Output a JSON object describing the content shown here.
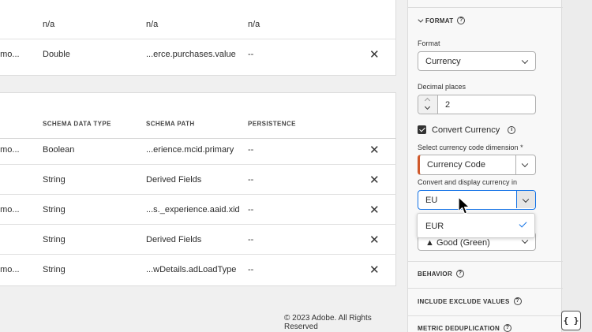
{
  "top_table": {
    "rows": [
      {
        "c1": "",
        "c2": "n/a",
        "c3": "n/a",
        "c4": "n/a",
        "remove": ""
      },
      {
        "c1": "emo...",
        "c2": "Double",
        "c3": "...erce.purchases.value",
        "c4": "--",
        "remove": "✕"
      }
    ]
  },
  "bottom_table": {
    "headers": [
      "SCHEMA DATA TYPE",
      "SCHEMA PATH",
      "PERSISTENCE"
    ],
    "rows": [
      {
        "c1": "emo...",
        "c2": "Boolean",
        "c3": "...erience.mcid.primary",
        "c4": "--",
        "remove": "✕"
      },
      {
        "c1": "",
        "c2": "String",
        "c3": "Derived Fields",
        "c4": "--",
        "remove": "✕"
      },
      {
        "c1": "emo...",
        "c2": "String",
        "c3": "...s._experience.aaid.xid",
        "c4": "--",
        "remove": "✕"
      },
      {
        "c1": "",
        "c2": "String",
        "c3": "Derived Fields",
        "c4": "--",
        "remove": "✕"
      },
      {
        "c1": "emo...",
        "c2": "String",
        "c3": "...wDetails.adLoadType",
        "c4": "--",
        "remove": "✕"
      }
    ]
  },
  "footer": {
    "copyright": "© 2023 Adobe. All Rights Reserved"
  },
  "panel": {
    "format_section": "FORMAT",
    "format_label": "Format",
    "format_value": "Currency",
    "decimal_label": "Decimal places",
    "decimal_value": "2",
    "convert_label": "Convert Currency",
    "currency_dim_label": "Select currency code dimension",
    "required_mark": "*",
    "currency_dim_value": "Currency Code",
    "convert_display_label": "Convert and display currency in",
    "convert_display_value": "EU",
    "dropdown_option": "EUR",
    "behind_value": "▲ Good (Green)",
    "behavior_section": "BEHAVIOR",
    "include_exclude_section": "INCLUDE EXCLUDE VALUES",
    "dedup_section": "METRIC DEDUPLICATION"
  },
  "json_button": "{ }",
  "colors": {
    "accent": "#d0592b",
    "focus": "#1473e6",
    "check": "#1473e6"
  }
}
